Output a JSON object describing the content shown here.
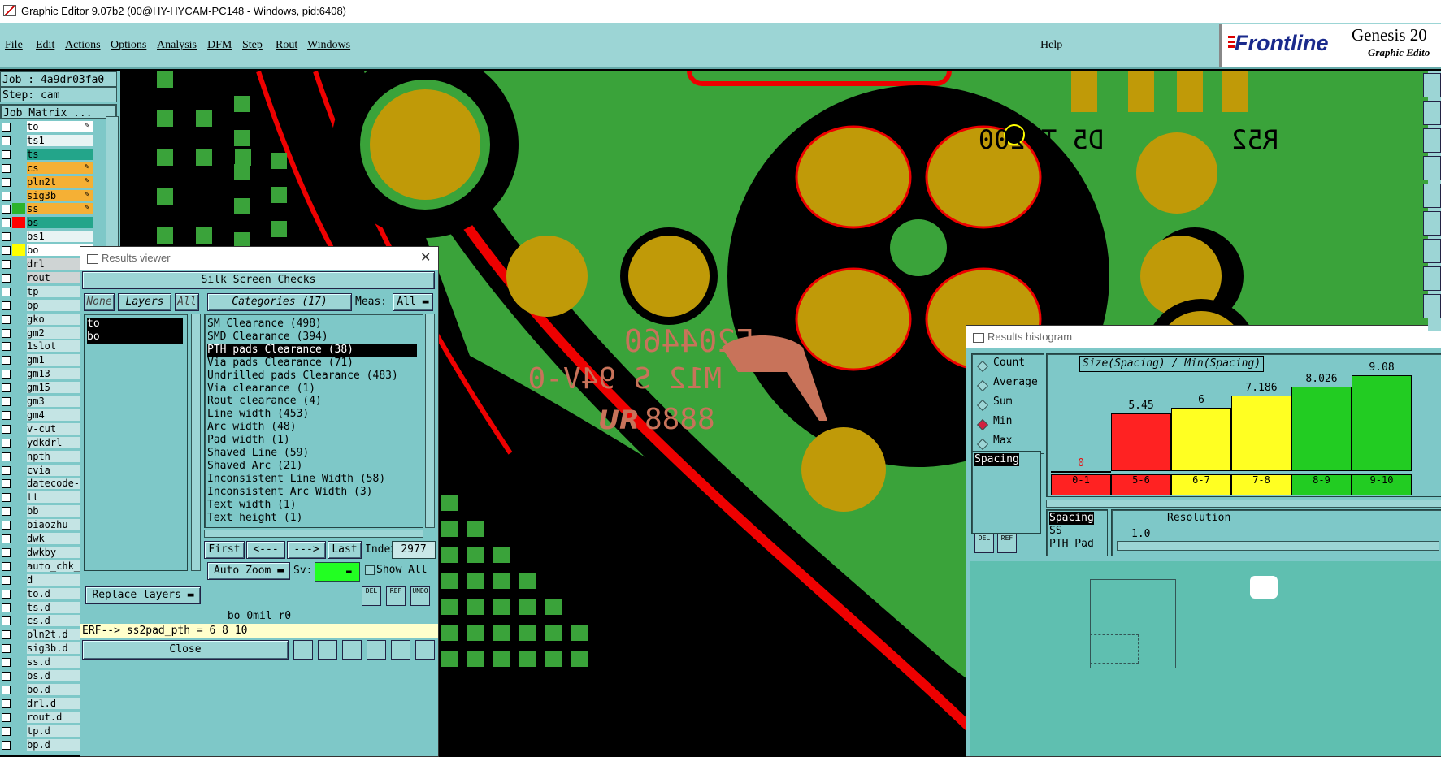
{
  "window": {
    "title": "Graphic Editor 9.07b2 (00@HY-HYCAM-PC148 - Windows, pid:6408)"
  },
  "menu": {
    "items": [
      "File",
      "Edit",
      "Actions",
      "Options",
      "Analysis",
      "DFM",
      "Step",
      "Rout",
      "Windows"
    ],
    "help": "Help"
  },
  "brand": {
    "name": "Frontline",
    "product": "Genesis 20",
    "subtitle": "Graphic Edito"
  },
  "job": {
    "job_label": "Job : 4a9dr03fa0",
    "step_label": "Step: cam",
    "matrix_button": "Job Matrix ..."
  },
  "layers": [
    {
      "name": "to",
      "bg": "#ffffff",
      "swatch": "",
      "pen": true
    },
    {
      "name": "ts1",
      "bg": "#e8f4f4",
      "swatch": "",
      "pen": false
    },
    {
      "name": "ts",
      "bg": "#23a58a",
      "swatch": "",
      "pen": false
    },
    {
      "name": "cs",
      "bg": "#f5b035",
      "swatch": "",
      "pen": true
    },
    {
      "name": "pln2t",
      "bg": "#f5b035",
      "swatch": "",
      "pen": true
    },
    {
      "name": "sig3b",
      "bg": "#f5b035",
      "swatch": "",
      "pen": true
    },
    {
      "name": "ss",
      "bg": "#f5b035",
      "swatch": "#2bb32b",
      "pen": true
    },
    {
      "name": "bs",
      "bg": "#23a58a",
      "swatch": "#ff0000",
      "pen": false
    },
    {
      "name": "bs1",
      "bg": "#e8f4f4",
      "swatch": "",
      "pen": false
    },
    {
      "name": "bo",
      "bg": "#ffffff",
      "swatch": "#ffff00",
      "pen": true
    },
    {
      "name": "drl",
      "bg": "#cfd4d4",
      "swatch": "",
      "pen": false
    },
    {
      "name": "rout",
      "bg": "#cfd4d4",
      "swatch": "",
      "pen": true
    },
    {
      "name": "tp",
      "bg": "#c4e4e4",
      "swatch": "",
      "pen": false
    },
    {
      "name": "bp",
      "bg": "#c4e4e4",
      "swatch": "",
      "pen": false
    },
    {
      "name": "gko",
      "bg": "#c4e4e4",
      "swatch": "",
      "pen": false
    },
    {
      "name": "gm2",
      "bg": "#c4e4e4",
      "swatch": "",
      "pen": false
    },
    {
      "name": "1slot",
      "bg": "#c4e4e4",
      "swatch": "",
      "pen": false
    },
    {
      "name": "gm1",
      "bg": "#c4e4e4",
      "swatch": "",
      "pen": false
    },
    {
      "name": "gm13",
      "bg": "#c4e4e4",
      "swatch": "",
      "pen": false
    },
    {
      "name": "gm15",
      "bg": "#c4e4e4",
      "swatch": "",
      "pen": false
    },
    {
      "name": "gm3",
      "bg": "#c4e4e4",
      "swatch": "",
      "pen": false
    },
    {
      "name": "gm4",
      "bg": "#c4e4e4",
      "swatch": "",
      "pen": false
    },
    {
      "name": "v-cut",
      "bg": "#c4e4e4",
      "swatch": "",
      "pen": false
    },
    {
      "name": "ydkdrl",
      "bg": "#c4e4e4",
      "swatch": "",
      "pen": false
    },
    {
      "name": "npth",
      "bg": "#c4e4e4",
      "swatch": "",
      "pen": false
    },
    {
      "name": "cvia",
      "bg": "#c4e4e4",
      "swatch": "",
      "pen": false
    },
    {
      "name": "datecode-pb",
      "bg": "#c4e4e4",
      "swatch": "",
      "pen": false
    },
    {
      "name": "tt",
      "bg": "#c4e4e4",
      "swatch": "",
      "pen": false
    },
    {
      "name": "bb",
      "bg": "#c4e4e4",
      "swatch": "",
      "pen": false
    },
    {
      "name": "biaozhu",
      "bg": "#c4e4e4",
      "swatch": "",
      "pen": false
    },
    {
      "name": "dwk",
      "bg": "#c4e4e4",
      "swatch": "",
      "pen": false
    },
    {
      "name": "dwkby",
      "bg": "#c4e4e4",
      "swatch": "",
      "pen": false
    },
    {
      "name": "auto_chk_pn",
      "bg": "#c4e4e4",
      "swatch": "",
      "pen": false
    },
    {
      "name": "d",
      "bg": "#c4e4e4",
      "swatch": "",
      "pen": false
    },
    {
      "name": "to.d",
      "bg": "#c4e4e4",
      "swatch": "",
      "pen": true
    },
    {
      "name": "ts.d",
      "bg": "#c4e4e4",
      "swatch": "",
      "pen": false
    },
    {
      "name": "cs.d",
      "bg": "#c4e4e4",
      "swatch": "",
      "pen": false
    },
    {
      "name": "pln2t.d",
      "bg": "#c4e4e4",
      "swatch": "",
      "pen": false
    },
    {
      "name": "sig3b.d",
      "bg": "#c4e4e4",
      "swatch": "",
      "pen": false
    },
    {
      "name": "ss.d",
      "bg": "#c4e4e4",
      "swatch": "",
      "pen": false
    },
    {
      "name": "bs.d",
      "bg": "#c4e4e4",
      "swatch": "",
      "pen": false
    },
    {
      "name": "bo.d",
      "bg": "#c4e4e4",
      "swatch": "",
      "pen": false
    },
    {
      "name": "drl.d",
      "bg": "#c4e4e4",
      "swatch": "",
      "pen": false
    },
    {
      "name": "rout.d",
      "bg": "#c4e4e4",
      "swatch": "",
      "pen": false
    },
    {
      "name": "tp.d",
      "bg": "#c4e4e4",
      "swatch": "",
      "pen": false
    },
    {
      "name": "bp.d",
      "bg": "#c4e4e4",
      "swatch": "",
      "pen": false
    }
  ],
  "board": {
    "silk_line1": "E204460",
    "silk_line2": "M12 S 94V-0",
    "silk_line3": "8888",
    "ul_mark": "UR",
    "refdes_top": "D5  TP200",
    "refdes_r": "R52"
  },
  "results_viewer": {
    "title": "Results viewer",
    "header": "Silk Screen Checks",
    "none_btn": "None",
    "layers_btn": "Layers",
    "all_btn": "All",
    "categories_btn": "Categories (17)",
    "meas_label": "Meas:",
    "meas_value": "All",
    "layers_list": [
      "to",
      "bo"
    ],
    "categories": [
      "SM Clearance (498)",
      "SMD Clearance (394)",
      "PTH pads Clearance (38)",
      "Via pads Clearance (71)",
      "Undrilled pads Clearance (483)",
      "Via clearance (1)",
      "Rout clearance (4)",
      "Line width (453)",
      "Arc width (48)",
      "Pad width (1)",
      "Shaved Line (59)",
      "Shaved Arc (21)",
      "Inconsistent Line Width (58)",
      "Inconsistent Arc Width (3)",
      "Text width (1)",
      "Text height (1)"
    ],
    "selected_category_index": 2,
    "nav": {
      "first": "First",
      "prev": "<---",
      "next": "--->",
      "last": "Last",
      "index_label": "Index:",
      "index_value": "2977"
    },
    "auto_zoom": "Auto Zoom",
    "sv_label": "Sv:",
    "show_all": "Show All",
    "replace_layers": "Replace layers",
    "status": "bo  0mil  r0",
    "erf": "ERF--> ss2pad_pth = 6 8 10",
    "close": "Close",
    "del": "DEL",
    "ref": "REF",
    "undo": "UNDO"
  },
  "histogram": {
    "title": "Results histogram",
    "options": [
      {
        "label": "Count",
        "on": false
      },
      {
        "label": "Average",
        "on": false
      },
      {
        "label": "Sum",
        "on": false
      },
      {
        "label": "Min",
        "on": true
      },
      {
        "label": "Max",
        "on": false
      }
    ],
    "measure_list": [
      "Spacing"
    ],
    "chart_title": "Size(Spacing) / Min(Spacing)",
    "info_list": [
      "Spacing",
      "SS",
      "PTH Pad"
    ],
    "resolution_label": "Resolution",
    "resolution_value": "1.0",
    "del": "DEL",
    "ref": "REF",
    "colors": {
      "red": "#ff2222",
      "yellow": "#ffff22",
      "green": "#22cc22"
    }
  },
  "chart_data": {
    "type": "bar",
    "categories": [
      "0-1",
      "5-6",
      "6-7",
      "7-8",
      "8-9",
      "9-10"
    ],
    "values": [
      0,
      5.45,
      6,
      7.186,
      8.026,
      9.08
    ],
    "title": "Size(Spacing) / Min(Spacing)",
    "xlabel": "",
    "ylabel": "",
    "ylim": [
      0,
      9.08
    ],
    "grid": false,
    "bar_colors": [
      "#ff2222",
      "#ff2222",
      "#ffff22",
      "#ffff22",
      "#22cc22",
      "#22cc22"
    ],
    "value_labels": [
      "0",
      "5.45",
      "6",
      "7.186",
      "8.026",
      "9.08"
    ]
  }
}
